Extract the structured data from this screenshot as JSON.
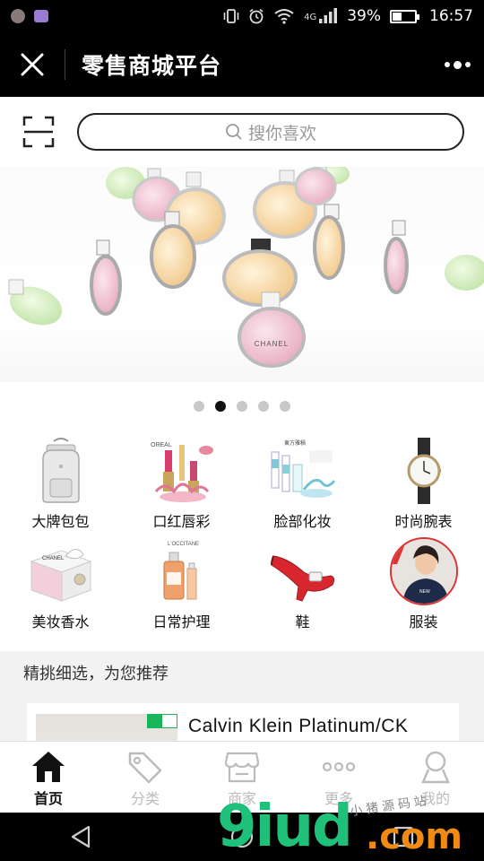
{
  "status_bar": {
    "network": "4G",
    "battery_percent": 39,
    "battery_text": "39%",
    "time": "16:57"
  },
  "title_bar": {
    "title": "零售商城平台"
  },
  "search": {
    "placeholder": "搜你喜欢"
  },
  "banner": {
    "slide_count": 5,
    "active_slide": 2,
    "brand_text": "CHANEL"
  },
  "categories": [
    {
      "label": "大牌包包",
      "icon": "backpack-image"
    },
    {
      "label": "口红唇彩",
      "icon": "lipstick-image"
    },
    {
      "label": "脸部化妆",
      "icon": "skincare-image"
    },
    {
      "label": "时尚腕表",
      "icon": "watch-image"
    },
    {
      "label": "美妆香水",
      "icon": "gift-box-image"
    },
    {
      "label": "日常护理",
      "icon": "lotion-bottle-image"
    },
    {
      "label": "鞋",
      "icon": "red-shoe-image"
    },
    {
      "label": "服装",
      "icon": "clothing-model-image"
    }
  ],
  "section": {
    "title": "精挑细选，为您推荐"
  },
  "products": [
    {
      "title": "Calvin Klein Platinum/CK"
    }
  ],
  "tabs": [
    {
      "label": "首页",
      "icon": "home-icon",
      "active": true
    },
    {
      "label": "分类",
      "icon": "tag-icon",
      "active": false
    },
    {
      "label": "商家",
      "icon": "store-icon",
      "active": false
    },
    {
      "label": "更多",
      "icon": "more-dots-icon",
      "active": false
    },
    {
      "label": "我的",
      "icon": "user-icon",
      "active": false
    }
  ],
  "watermark": {
    "logo": "9iud",
    "domain": ".com",
    "text": "小猪源码站"
  },
  "colors": {
    "header_bg": "#000000",
    "accent_dot": "#111111",
    "watermark_green": "#1fc07a",
    "watermark_orange": "#f08a12",
    "tag_green": "#19b55a"
  }
}
